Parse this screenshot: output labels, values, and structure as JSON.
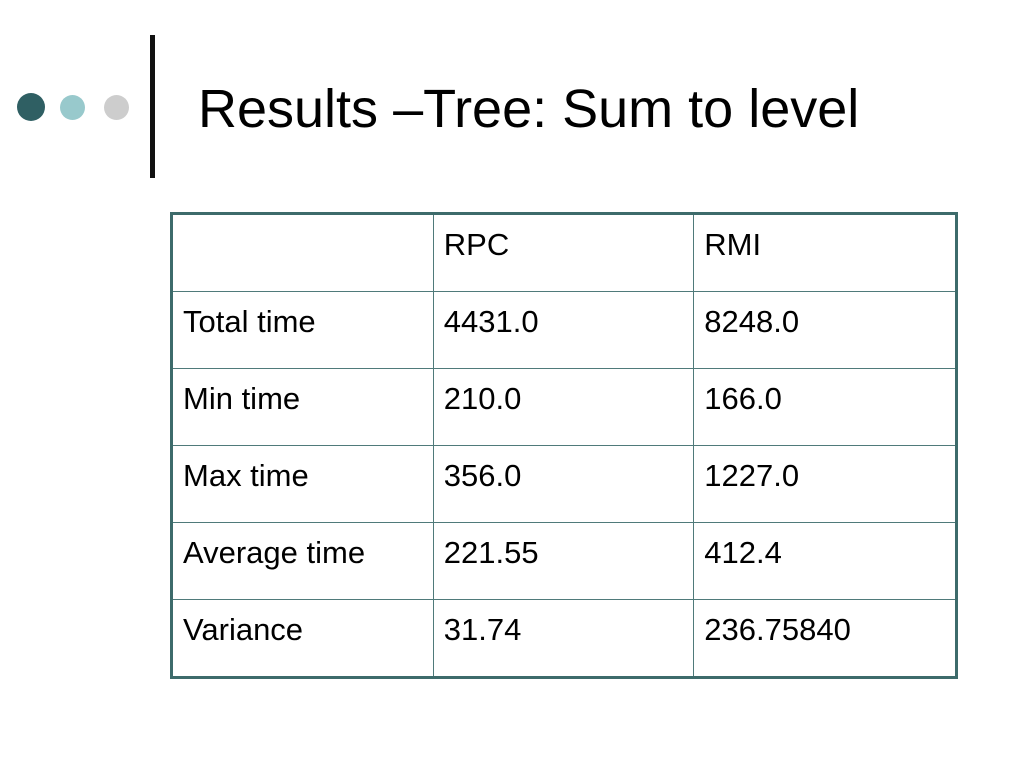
{
  "slide": {
    "title": "Results –Tree: Sum to level",
    "bullet_colors": [
      "#2f5f63",
      "#98c9cc",
      "#cdcdcd"
    ]
  },
  "table": {
    "header": [
      "",
      "RPC",
      "RMI"
    ],
    "rows": [
      [
        "Total time",
        "4431.0",
        "8248.0"
      ],
      [
        "Min time",
        "210.0",
        "166.0"
      ],
      [
        "Max time",
        "356.0",
        "1227.0"
      ],
      [
        "Average time",
        "221.55",
        "412.4"
      ],
      [
        "Variance",
        "31.74",
        "236.75840"
      ]
    ]
  }
}
